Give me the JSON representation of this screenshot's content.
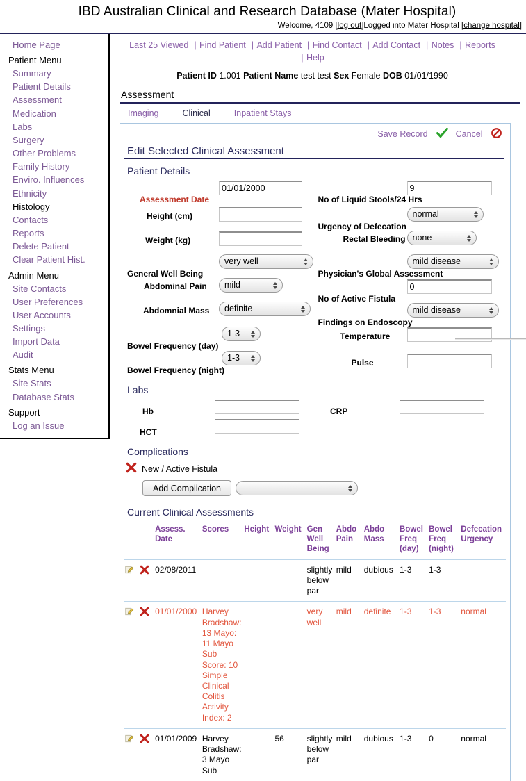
{
  "header": {
    "app_title": "IBD Australian Clinical and Research Database (Mater Hospital)",
    "welcome_prefix": "Welcome, 4109 ",
    "logout_label": "[log out]",
    "logged_into": "Logged into Mater Hospital ",
    "change_hospital_label": "[change hospital]"
  },
  "sidebar": {
    "home_label": "Home Page",
    "groups": [
      {
        "heading": "Patient Menu",
        "items": [
          {
            "label": "Summary",
            "link": true
          },
          {
            "label": "Patient Details",
            "link": true
          },
          {
            "label": "Assessment",
            "link": true
          },
          {
            "label": "Medication",
            "link": true
          },
          {
            "label": "Labs",
            "link": true
          },
          {
            "label": "Surgery",
            "link": true
          },
          {
            "label": "Other Problems",
            "link": true
          },
          {
            "label": "Family History",
            "link": true
          },
          {
            "label": "Enviro. Influences",
            "link": true
          },
          {
            "label": "Ethnicity",
            "link": true
          },
          {
            "label": "Histology",
            "link": false
          },
          {
            "label": "Contacts",
            "link": true
          },
          {
            "label": "Reports",
            "link": true
          },
          {
            "label": "Delete Patient",
            "link": true
          },
          {
            "label": "Clear Patient Hist.",
            "link": true
          }
        ]
      },
      {
        "heading": "Admin Menu",
        "items": [
          {
            "label": "Site Contacts",
            "link": true
          },
          {
            "label": "User Preferences",
            "link": true
          },
          {
            "label": "User Accounts",
            "link": true
          },
          {
            "label": "Settings",
            "link": true
          },
          {
            "label": "Import Data",
            "link": true
          },
          {
            "label": "Audit",
            "link": true
          }
        ]
      },
      {
        "heading": "Stats Menu",
        "items": [
          {
            "label": "Site Stats",
            "link": true
          },
          {
            "label": "Database Stats",
            "link": true
          }
        ]
      },
      {
        "heading": "Support",
        "items": [
          {
            "label": "Log an Issue",
            "link": true
          }
        ]
      }
    ]
  },
  "top_nav": {
    "items": [
      "Last 25 Viewed",
      "Find Patient",
      "Add Patient",
      "Find Contact",
      "Add Contact",
      "Notes",
      "Reports",
      "Help"
    ]
  },
  "patient_bar": {
    "id_label": "Patient ID",
    "id_value": "1.001",
    "name_label": "Patient Name",
    "name_value": "test test",
    "sex_label": "Sex",
    "sex_value": "Female",
    "dob_label": "DOB",
    "dob_value": "01/01/1990"
  },
  "section": {
    "title": "Assessment"
  },
  "tabs": [
    {
      "label": "Imaging",
      "active": false
    },
    {
      "label": "Clinical",
      "active": true
    },
    {
      "label": "Inpatient Stays",
      "active": false
    }
  ],
  "record_actions": {
    "save_label": "Save Record",
    "cancel_label": "Cancel"
  },
  "panel": {
    "title": "Edit Selected Clinical Assessment",
    "patient_details_heading": "Patient Details",
    "labs_heading": "Labs",
    "complications_heading": "Complications",
    "current_assessments_heading": "Current Clinical Assessments"
  },
  "form": {
    "assessment_date": {
      "label": "Assessment Date",
      "value": "01/01/2000"
    },
    "height": {
      "label": "Height (cm)",
      "value": ""
    },
    "weight": {
      "label": "Weight (kg)",
      "value": ""
    },
    "general_well_being": {
      "label": "General Well Being",
      "value": "very well"
    },
    "abdominal_pain": {
      "label": "Abdominal Pain",
      "value": "mild"
    },
    "abdominal_mass": {
      "label": "Abdomnial Mass",
      "value": "definite"
    },
    "bowel_freq_day": {
      "label": "Bowel Frequency (day)",
      "value": "1-3"
    },
    "bowel_freq_night": {
      "label": "Bowel Frequency (night)",
      "value": "1-3"
    },
    "liquid_stools": {
      "label": "No of Liquid Stools/24 Hrs",
      "value": "9"
    },
    "urgency_defecation": {
      "label": "Urgency of Defecation",
      "value": "normal"
    },
    "rectal_bleeding": {
      "label": "Rectal Bleeding",
      "value": "none"
    },
    "physicians_global": {
      "label": "Physician's Global Assessment",
      "value": "mild disease"
    },
    "active_fistula": {
      "label": "No of Active Fistula",
      "value": "0"
    },
    "findings_endoscopy": {
      "label": "Findings on Endoscopy",
      "value": "mild disease"
    },
    "temperature": {
      "label": "Temperature",
      "value": ""
    },
    "pulse": {
      "label": "Pulse",
      "value": ""
    },
    "hb": {
      "label": "Hb",
      "value": ""
    },
    "hct": {
      "label": "HCT",
      "value": ""
    },
    "crp": {
      "label": "CRP",
      "value": ""
    }
  },
  "complications": {
    "existing": [
      {
        "label": "New / Active Fistula"
      }
    ],
    "add_button_label": "Add Complication",
    "select_value": ""
  },
  "assessments_table": {
    "columns": [
      "",
      "Assess. Date",
      "Scores",
      "Height",
      "Weight",
      "Gen Well Being",
      "Abdo Pain",
      "Abdo Mass",
      "Bowel Freq (day)",
      "Bowel Freq (night)",
      "Defecation Urgency"
    ],
    "rows": [
      {
        "selected": false,
        "date": "02/08/2011",
        "scores": "",
        "height": "",
        "weight": "",
        "gen_well_being": "slightly below par",
        "abdo_pain": "mild",
        "abdo_mass": "dubious",
        "bowel_freq_day": "1-3",
        "bowel_freq_night": "1-3",
        "defecation_urgency": ""
      },
      {
        "selected": true,
        "date": "01/01/2000",
        "scores": "Harvey Bradshaw: 13 Mayo: 11 Mayo Sub Score: 10 Simple Clinical Colitis Activity Index: 2",
        "height": "",
        "weight": "",
        "gen_well_being": "very well",
        "abdo_pain": "mild",
        "abdo_mass": "definite",
        "bowel_freq_day": "1-3",
        "bowel_freq_night": "1-3",
        "defecation_urgency": "normal"
      },
      {
        "selected": false,
        "date": "01/01/2009",
        "scores": "Harvey Bradshaw: 3 Mayo Sub",
        "height": "",
        "weight": "56",
        "gen_well_being": "slightly below par",
        "abdo_pain": "mild",
        "abdo_mass": "dubious",
        "bowel_freq_day": "1-3",
        "bowel_freq_night": "0",
        "defecation_urgency": "normal"
      }
    ]
  },
  "colors": {
    "link": "#8a5fa8",
    "heading": "#2b2b5e",
    "required": "#c0392b",
    "selected_row": "#e2553d",
    "table_header": "#7b3f98",
    "panel_border": "#a9c6e0"
  }
}
